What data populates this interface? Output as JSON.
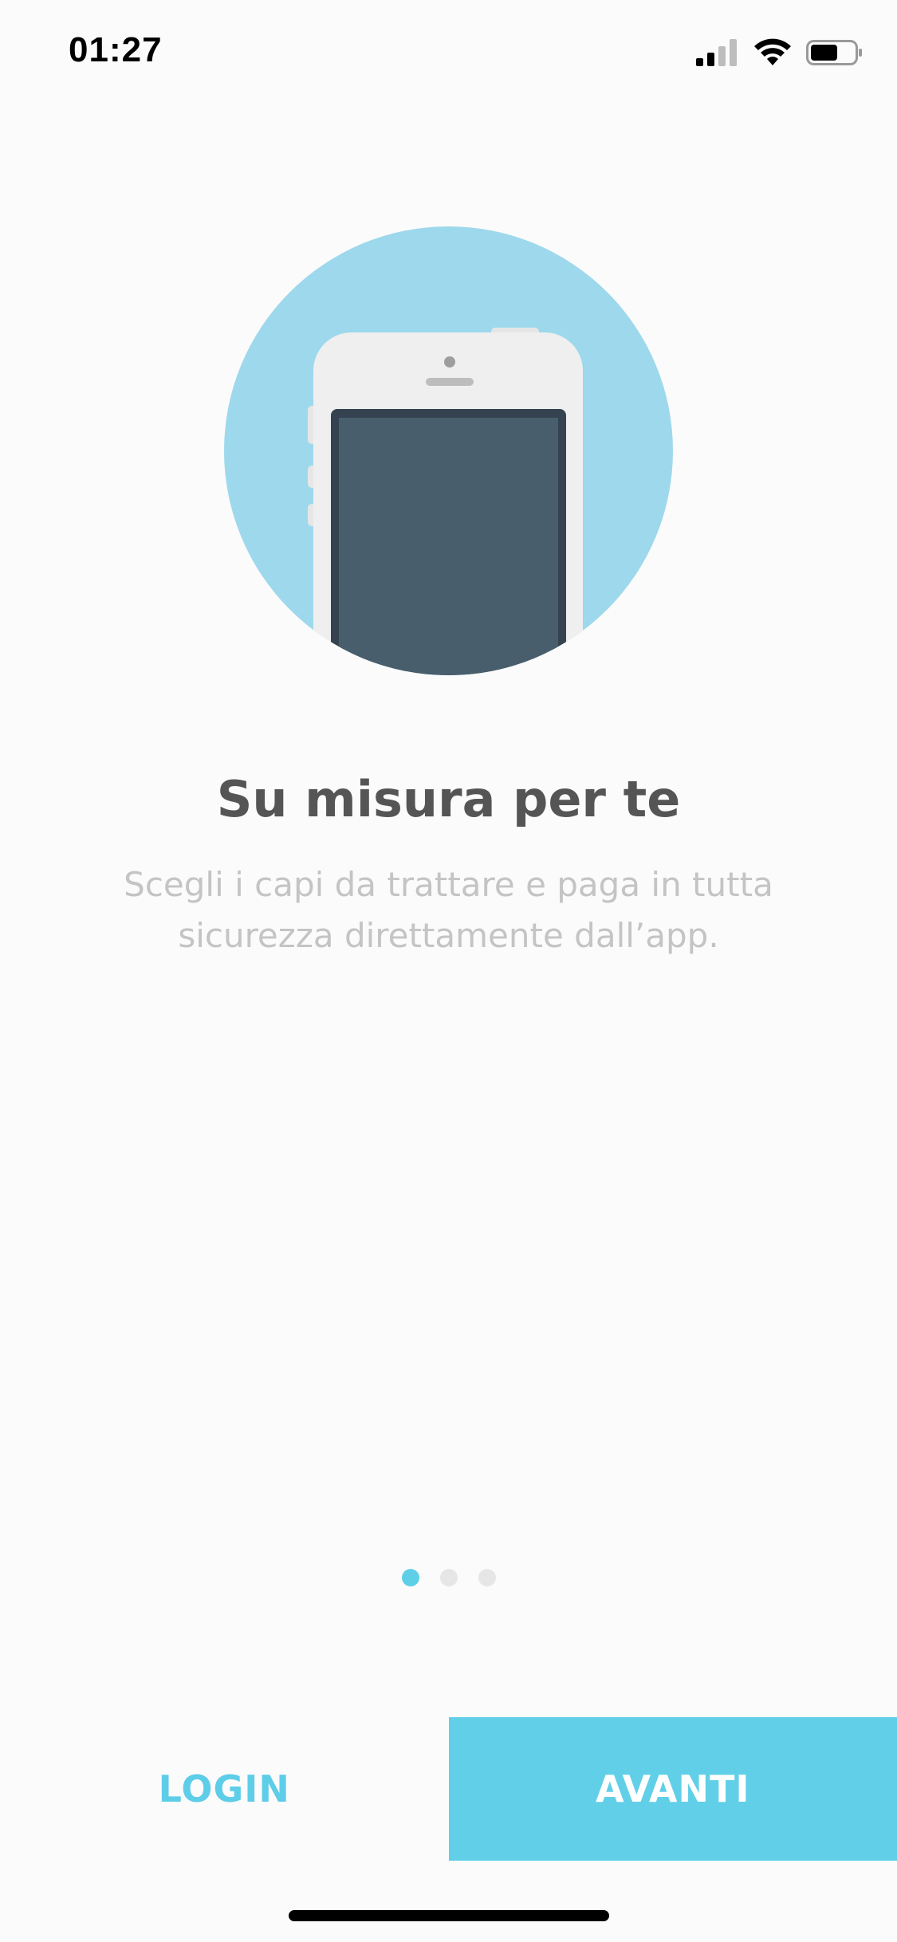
{
  "status_bar": {
    "time": "01:27",
    "icons": [
      "cellular-signal-icon",
      "wifi-icon",
      "battery-icon"
    ]
  },
  "onboarding": {
    "illustration": "smartphone-illustration",
    "title": "Su misura per te",
    "subtitle": "Scegli i capi da trattare  e paga in tutta sicurezza direttamente dall’app.",
    "page_indicator": {
      "total": 3,
      "active": 1
    }
  },
  "actions": {
    "login_label": "LOGIN",
    "next_label": "AVANTI"
  },
  "colors": {
    "accent": "#62cfe8",
    "circle": "#9ed8ec",
    "phone_screen": "#485e6c",
    "title": "#555555",
    "subtitle": "#c4c4c4"
  }
}
